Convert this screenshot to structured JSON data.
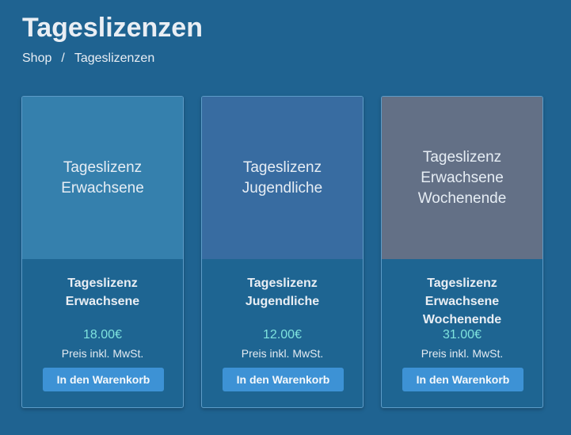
{
  "page": {
    "title": "Tageslizenzen"
  },
  "breadcrumb": {
    "items": [
      "Shop",
      "Tageslizenzen"
    ],
    "separator": "/"
  },
  "products": [
    {
      "image_text": "Tageslizenz\nErwachsene",
      "image_color": "#3580ad",
      "name": "Tageslizenz\nErwachsene",
      "price": "18.00€",
      "tax_note": "Preis inkl. MwSt.",
      "button_label": "In den Warenkorb"
    },
    {
      "image_text": "Tageslizenz\nJugendliche",
      "image_color": "#386ca1",
      "name": "Tageslizenz\nJugendliche",
      "price": "12.00€",
      "tax_note": "Preis inkl. MwSt.",
      "button_label": "In den Warenkorb"
    },
    {
      "image_text": "Tageslizenz\nErwachsene\nWochenende",
      "image_color": "#637086",
      "name": "Tageslizenz\nErwachsene\nWochenende",
      "price": "31.00€",
      "tax_note": "Preis inkl. MwSt.",
      "button_label": "In den Warenkorb"
    }
  ],
  "colors": {
    "background": "#1f6391",
    "price": "#7fe3de",
    "button": "#3d92d5"
  }
}
